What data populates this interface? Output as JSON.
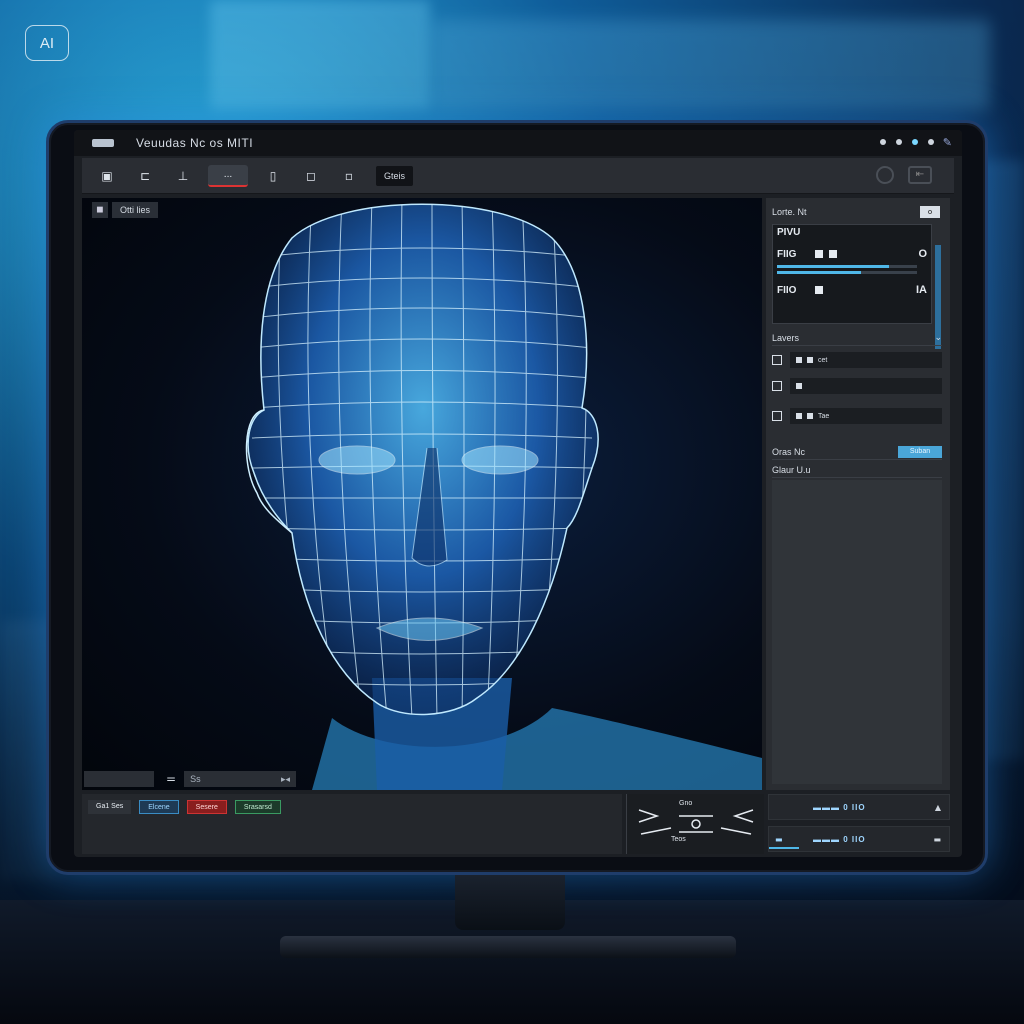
{
  "badge": {
    "label": "AI"
  },
  "window": {
    "title": "Veuudas  Nc  os  MITI"
  },
  "toolbar": {
    "active_tool_label": "...",
    "text_button_label": "Gteis",
    "tools": [
      "▣",
      "⊏",
      "⊥",
      "▯",
      "◻",
      "▫"
    ]
  },
  "viewport": {
    "tag_label": "Otti lies",
    "footer_field_left": "",
    "footer_eq": "=",
    "footer_field_right": "Ss",
    "footer_field_right_end": "▸◂"
  },
  "right_panel": {
    "header_label": "Lorte. Nt",
    "header_button": "o",
    "props_title": "PIVU",
    "props": [
      {
        "key": "FIIG",
        "value": "O"
      },
      {
        "key": "FIIO",
        "value": "IA"
      }
    ],
    "layers_header": "Lavers",
    "layers": [
      {
        "label": "cet"
      },
      {
        "label": ""
      },
      {
        "label": "Tae"
      }
    ],
    "section2_header": "Oras Nc",
    "section2_button": "Suban",
    "section3_header": "Glaur  U.u"
  },
  "bottom": {
    "buttons": [
      {
        "label": "Ga1  Ses"
      },
      {
        "label": "Elcene",
        "style": "blue"
      },
      {
        "label": "Sesere",
        "style": "red"
      },
      {
        "label": "Srasarsd",
        "style": "green"
      }
    ],
    "mid_top": "Gno",
    "mid_bottom": "Teos",
    "right_rows": [
      {
        "text": "▬▬▬ 0 IIO",
        "icon": "▲"
      },
      {
        "text": "▬▬▬ 0 IIO",
        "icon": "▬"
      }
    ]
  }
}
